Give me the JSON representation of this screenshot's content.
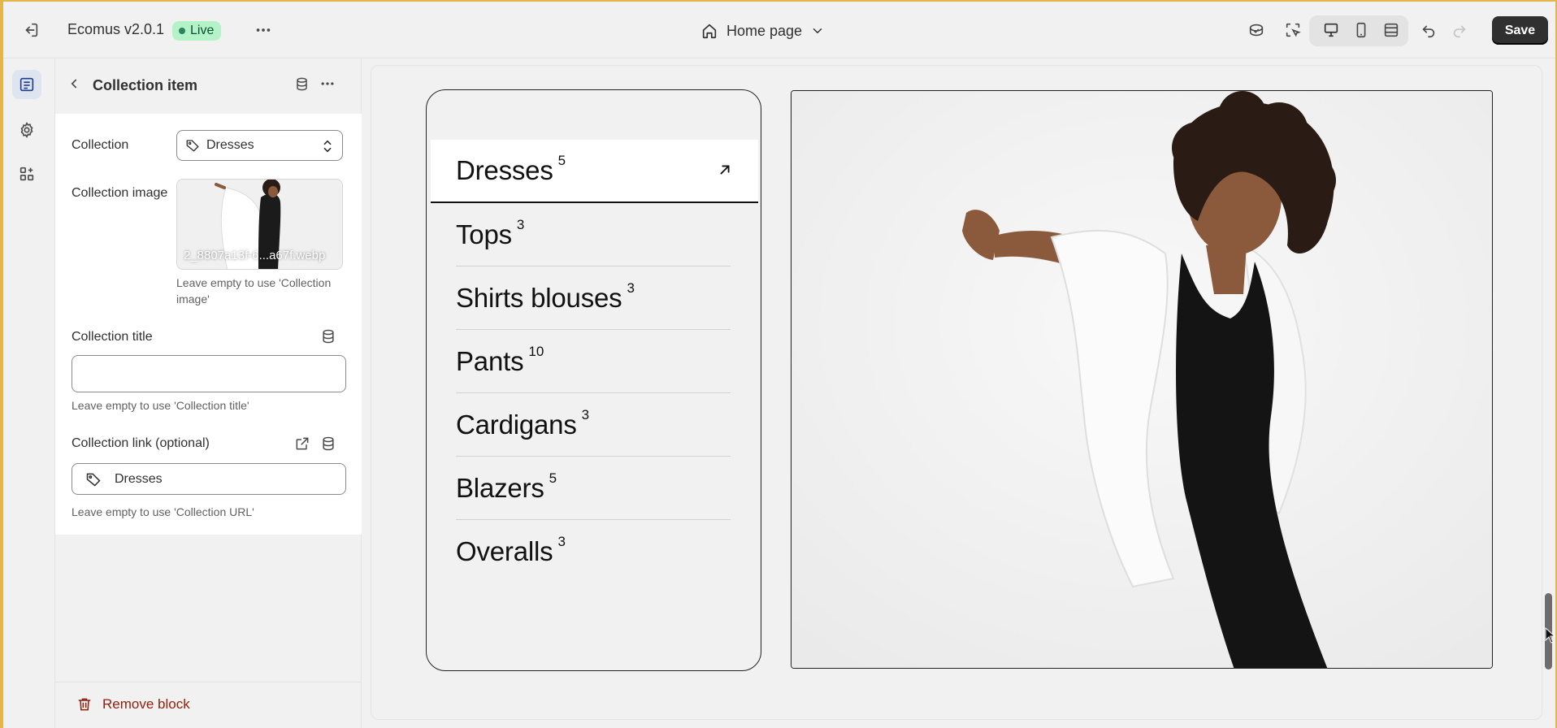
{
  "topbar": {
    "app_name": "Ecomus v2.0.1",
    "status_badge": "Live",
    "page_selector": "Home page",
    "save_label": "Save"
  },
  "panel": {
    "title": "Collection item",
    "collection": {
      "label": "Collection",
      "value": "Dresses"
    },
    "collection_image": {
      "label": "Collection image",
      "filename": "2_8807a13f-6...a67f.webp",
      "help": "Leave empty to use 'Collection image'"
    },
    "collection_title": {
      "label": "Collection title",
      "value": "",
      "help": "Leave empty to use 'Collection title'"
    },
    "collection_link": {
      "label": "Collection link (optional)",
      "value": "Dresses",
      "help": "Leave empty to use 'Collection URL'"
    },
    "remove_label": "Remove block"
  },
  "preview": {
    "collections": [
      {
        "name": "Dresses",
        "count": "5"
      },
      {
        "name": "Tops",
        "count": "3"
      },
      {
        "name": "Shirts blouses",
        "count": "3"
      },
      {
        "name": "Pants",
        "count": "10"
      },
      {
        "name": "Cardigans",
        "count": "3"
      },
      {
        "name": "Blazers",
        "count": "5"
      },
      {
        "name": "Overalls",
        "count": "3"
      }
    ]
  },
  "colors": {
    "save_bg": "#303030",
    "live_bg": "#b4f2c8",
    "remove": "#8e1f0b",
    "frame": "#e4b54a"
  },
  "icons": {
    "exit": "exit-icon",
    "more": "more-horizontal-icon",
    "home": "home-icon",
    "chevron": "chevron-down-icon",
    "sections": "sections-icon",
    "settings": "gear-icon",
    "apps": "apps-icon",
    "back": "chevron-left-icon",
    "database": "database-icon",
    "tag": "tag-icon",
    "external": "external-link-icon",
    "delete": "trash-icon"
  }
}
